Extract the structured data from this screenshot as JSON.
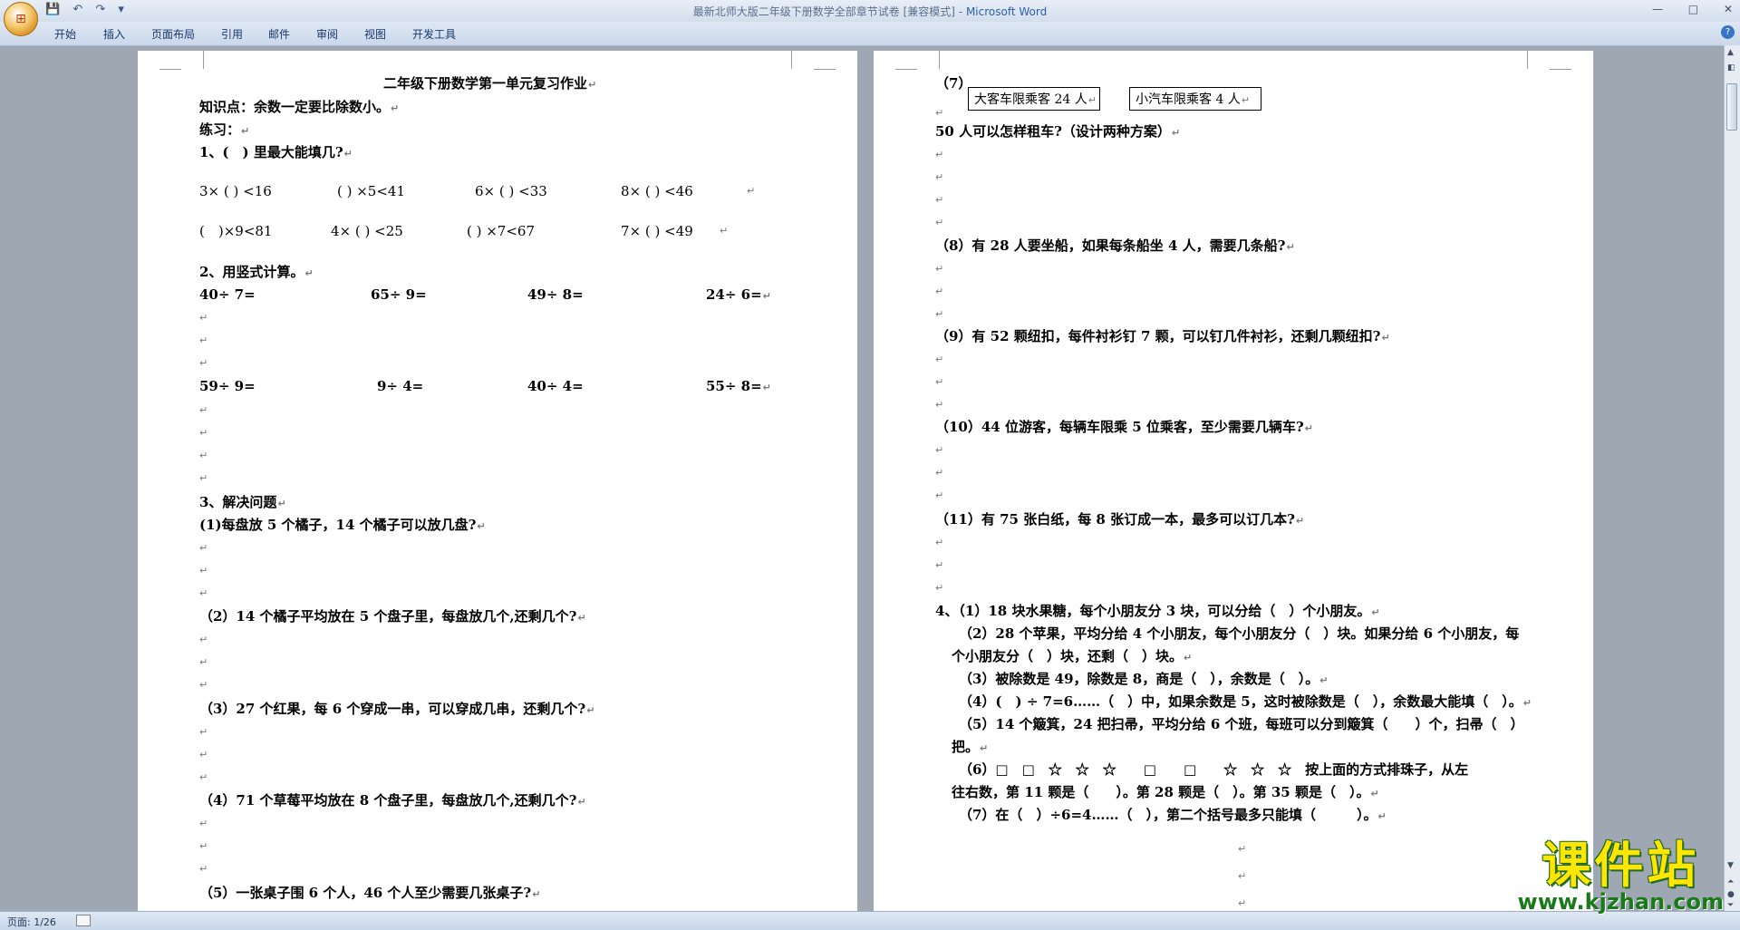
{
  "window": {
    "title": "最新北师大版二年级下册数学全部章节试卷 [兼容模式]",
    "app": "Microsoft Word",
    "controls": [
      "—",
      "□",
      "✕"
    ]
  },
  "quick_access": [
    "💾",
    "↶",
    "↷",
    "▾"
  ],
  "menu": {
    "tabs": [
      "开始",
      "插入",
      "页面布局",
      "引用",
      "邮件",
      "审阅",
      "视图",
      "开发工具"
    ],
    "help": "?"
  },
  "page1": {
    "title": "二年级下册数学第一单元复习作业",
    "kp": "知识点：余数一定要比除数小。",
    "practice": "练习：",
    "q1": "1、(　) 里最大能填几?",
    "q1_items": [
      "3× ( ) <16",
      "( ) ×5<41",
      "6× ( ) <33",
      "8× ( ) <46",
      "(　)×9<81",
      "4× ( ) <25",
      "( ) ×7<67",
      "7× ( ) <49"
    ],
    "q2": "2、用竖式计算。",
    "q2_row1": [
      "40÷ 7=",
      "65÷ 9=",
      "49÷ 8=",
      "24÷ 6="
    ],
    "q2_row2": [
      "59÷ 9=",
      "9÷ 4=",
      "40÷ 4=",
      "55÷ 8="
    ],
    "q3": "3、解决问题",
    "p1": "(1)每盘放 5 个橘子，14 个橘子可以放几盘?",
    "p2": "（2）14 个橘子平均放在 5 个盘子里，每盘放几个,还剩几个?",
    "p3": "（3）27 个红果，每 6 个穿成一串，可以穿成几串，还剩几个?",
    "p4": "（4）71 个草莓平均放在 8 个盘子里，每盘放几个,还剩几个?",
    "p5": "（5）一张桌子围 6 个人，46 个人至少需要几张桌子?"
  },
  "page2": {
    "p7_label": "（7）",
    "box1": "大客车限乘客 24 人",
    "box2": "小汽车限乘客 4 人",
    "p7_q": "50 人可以怎样租车?（设计两种方案）",
    "p8": "（8）有 28 人要坐船，如果每条船坐 4 人，需要几条船?",
    "p9": "（9）有 52 颗纽扣，每件衬衫钉 7 颗，可以钉几件衬衫，还剩几颗纽扣?",
    "p10": "（10）44 位游客，每辆车限乘 5 位乘客，至少需要几辆车?",
    "p11": "（11）有 75 张白纸，每 8 张订成一本，最多可以订几本?",
    "s4_1": "4、（1）18 块水果糖，每个小朋友分 3 块，可以分给（　）个小朋友。",
    "s4_2a": "（2）28 个苹果，平均分给 4 个小朋友，每个小朋友分（　）块。如果分给 6 个小朋友，每",
    "s4_2b": "个小朋友分（　）块，还剩（　）块。",
    "s4_3": "（3）被除数是 49，除数是 8，商是（　），余数是（　）。",
    "s4_4": "（4）(　) ÷ 7=6……（　）中，如果余数是 5，这时被除数是（　），余数最大能填（　）。",
    "s4_5a": "（5）14 个簸箕，24 把扫帚，平均分给 6 个班，每班可以分到簸箕（　　）个，扫帚（　）",
    "s4_5b": "把。",
    "s4_6a": "（6）□　□　☆　☆　☆　　□　　□　　☆　☆　☆　按上面的方式排珠子，从左",
    "s4_6b": "往右数，第 11 颗是（　　）。第 28 颗是（　）。第 35 颗是（　）。",
    "s4_7": "（7）在（　）÷6=4……（　），第二个括号最多只能填（　　　）。"
  },
  "para_mark": "↵",
  "status": {
    "page": "页面: 1/26"
  },
  "watermark": {
    "name": "课件站",
    "url": "www.kjzhan.com"
  }
}
